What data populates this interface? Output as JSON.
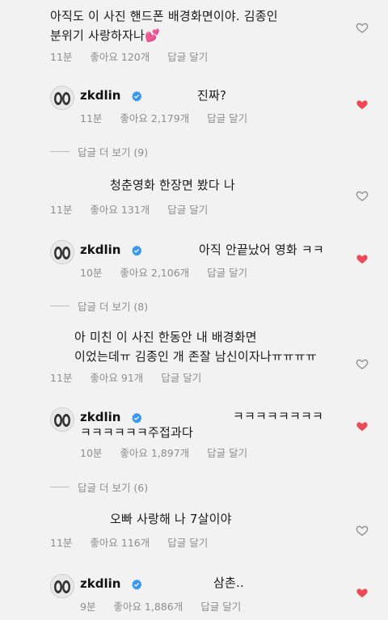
{
  "comments": [
    {
      "text": "아직도 이 사진 핸드폰 배경화면이야. 김종인\n분위기 사랑하자나💕",
      "time": "11분",
      "likes": "좋아요 120개",
      "reply": "답글 달기"
    },
    {
      "username": "zkdlin",
      "text": "진짜?",
      "time": "11분",
      "likes": "좋아요 2,179개",
      "reply": "답글 달기"
    },
    {
      "text": "청춘영화 한장면 봤다 나",
      "time": "11분",
      "likes": "좋아요 131개",
      "reply": "답글 달기"
    },
    {
      "username": "zkdlin",
      "text": "아직 안끝났어 영화 ㅋㅋ",
      "time": "10분",
      "likes": "좋아요 2,106개",
      "reply": "답글 달기"
    },
    {
      "text": "아 미친 이 사진 한동안 내 배경화면\n이었는데ㅠ 김종인 개 존잘 남신이자나ㅠㅠㅠㅠ",
      "time": "11분",
      "likes": "좋아요 91개",
      "reply": "답글 달기"
    },
    {
      "username": "zkdlin",
      "text": "ㅋㅋㅋㅋㅋㅋㅋㅋ",
      "text2": "ㅋㅋㅋㅋㅋㅋ주접과다",
      "time": "10분",
      "likes": "좋아요 1,897개",
      "reply": "답글 달기"
    },
    {
      "text": "오빠 사랑해 나 7살이야",
      "time": "11분",
      "likes": "좋아요 116개",
      "reply": "답글 달기"
    },
    {
      "username": "zkdlin",
      "text": "삼촌..",
      "time": "9분",
      "likes": "좋아요 1,886개",
      "reply": "답글 달기"
    }
  ],
  "more_replies": [
    "답글 더 보기 (9)",
    "답글 더 보기 (8)",
    "답글 더 보기 (6)"
  ],
  "colors": {
    "liked": "#ed4956",
    "verified": "#3897f0",
    "muted": "#8e8e8e"
  },
  "icons": {
    "like": "heart-outline-icon",
    "liked": "heart-filled-icon",
    "verified": "verified-badge-icon"
  }
}
